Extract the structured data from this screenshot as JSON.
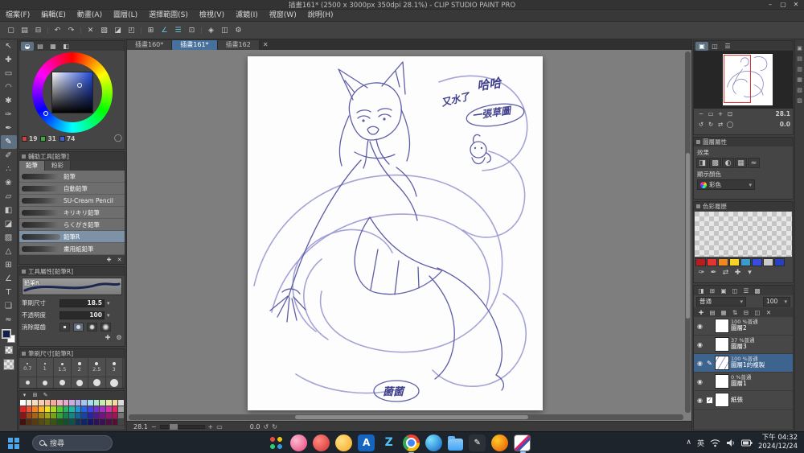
{
  "colors": {
    "accent": "#46719c",
    "selection": "#7d92a6",
    "layer_selection": "#3d648f",
    "foreground_color": "#131f4a",
    "sketch_line": "#9a9ad0",
    "taskbar": "#1d242c"
  },
  "glyphs": {
    "dropdown": "▾",
    "close": "✕",
    "eye": "◉",
    "edit": "✎",
    "check": "✓",
    "minus": "−",
    "plus": "+",
    "undo": "↺",
    "redo": "↻",
    "chevron_up": "∧",
    "fit": "▭",
    "app_a": "A",
    "app_z": "Z",
    "mix": "◯"
  },
  "window": {
    "title": "插畫161* (2500 x 3000px 350dpi 28.1%) - CLIP STUDIO PAINT PRO",
    "minimize": "–",
    "maximize": "▢",
    "close": "✕"
  },
  "menu": {
    "items": [
      "檔案(F)",
      "編輯(E)",
      "動畫(A)",
      "圖層(L)",
      "選擇範圍(S)",
      "檢視(V)",
      "濾鏡(I)",
      "視窗(W)",
      "說明(H)"
    ]
  },
  "toolbar": {
    "icons": [
      {
        "name": "new-file-icon",
        "glyph": "▢"
      },
      {
        "name": "open-file-icon",
        "glyph": "▤"
      },
      {
        "name": "save-file-icon",
        "glyph": "⊟"
      },
      {
        "name": "separator",
        "glyph": "|",
        "sep": true
      },
      {
        "name": "undo-icon",
        "glyph": "↶"
      },
      {
        "name": "redo-icon",
        "glyph": "↷"
      },
      {
        "name": "separator",
        "glyph": "|",
        "sep": true
      },
      {
        "name": "deselect-icon",
        "glyph": "✕"
      },
      {
        "name": "invert-selection-icon",
        "glyph": "▧"
      },
      {
        "name": "fill-icon",
        "glyph": "◪"
      },
      {
        "name": "transform-icon",
        "glyph": "◰"
      },
      {
        "name": "separator",
        "glyph": "|",
        "sep": true
      },
      {
        "name": "grid-icon",
        "glyph": "⊞"
      },
      {
        "name": "snap-ruler-icon",
        "glyph": "∠",
        "color": "#66c8e8"
      },
      {
        "name": "snap-special-ruler-icon",
        "glyph": "☰",
        "color": "#66c8e8"
      },
      {
        "name": "snap-grid-icon",
        "glyph": "⊡"
      },
      {
        "name": "separator",
        "glyph": "|",
        "sep": true
      },
      {
        "name": "symmetry-icon",
        "glyph": "◈"
      },
      {
        "name": "onion-skin-icon",
        "glyph": "◫"
      },
      {
        "name": "settings-gear-icon",
        "glyph": "⚙"
      }
    ]
  },
  "doc_tabs": {
    "tabs": [
      {
        "label": "插畫160*"
      },
      {
        "label": "插畫161*",
        "active": true
      },
      {
        "label": "插畫162"
      }
    ]
  },
  "tool_strip": {
    "icons": [
      {
        "name": "operate-tool-icon",
        "glyph": "↖"
      },
      {
        "name": "move-layer-tool-icon",
        "glyph": "✚"
      },
      {
        "name": "marquee-tool-icon",
        "glyph": "▭"
      },
      {
        "name": "lasso-tool-icon",
        "glyph": "◠"
      },
      {
        "name": "auto-select-tool-icon",
        "glyph": "✱"
      },
      {
        "name": "eyedropper-tool-icon",
        "glyph": "✑"
      },
      {
        "name": "pen-tool-icon",
        "glyph": "✒"
      },
      {
        "name": "pencil-tool-icon",
        "glyph": "✎",
        "active": true
      },
      {
        "name": "brush-tool-icon",
        "glyph": "✐"
      },
      {
        "name": "airbrush-tool-icon",
        "glyph": "∴"
      },
      {
        "name": "decoration-tool-icon",
        "glyph": "❀"
      },
      {
        "name": "eraser-tool-icon",
        "glyph": "▱"
      },
      {
        "name": "blend-tool-icon",
        "glyph": "◧"
      },
      {
        "name": "fill-tool-icon",
        "glyph": "◪"
      },
      {
        "name": "gradient-tool-icon",
        "glyph": "▨"
      },
      {
        "name": "figure-tool-icon",
        "glyph": "△"
      },
      {
        "name": "frame-border-tool-icon",
        "glyph": "⊞"
      },
      {
        "name": "ruler-tool-icon",
        "glyph": "∠"
      },
      {
        "name": "text-tool-icon",
        "glyph": "T"
      },
      {
        "name": "balloon-tool-icon",
        "glyph": "❏"
      },
      {
        "name": "line-correction-tool-icon",
        "glyph": "≈"
      }
    ]
  },
  "color_wheel": {
    "tabs": [
      {
        "name": "color-wheel-tab-icon",
        "glyph": "◒",
        "active": true
      },
      {
        "name": "color-slider-tab-icon",
        "glyph": "▤"
      },
      {
        "name": "color-set-tab-icon",
        "glyph": "▦"
      },
      {
        "name": "intermediate-color-tab-icon",
        "glyph": "◧"
      }
    ],
    "r": "19",
    "g": "31",
    "b": "74"
  },
  "sub_tool": {
    "title": "輔助工具[鉛筆]",
    "tabs": [
      "鉛筆",
      "粉彩"
    ],
    "items": [
      {
        "label": "鉛筆"
      },
      {
        "label": "自動鉛筆"
      },
      {
        "label": "SU-Cream Pencil"
      },
      {
        "label": "キリキリ鉛筆"
      },
      {
        "label": "らくがき鉛筆"
      },
      {
        "label": "鉛筆R",
        "selected": true
      },
      {
        "label": "畫用紙鉛筆"
      }
    ],
    "footer_icons": [
      {
        "name": "add-subtool-icon",
        "glyph": "✚"
      },
      {
        "name": "delete-subtool-icon",
        "glyph": "✕"
      }
    ]
  },
  "tool_property": {
    "title": "工具屬性[鉛筆R]",
    "brush_label": "鉛筆R",
    "size_label": "筆刷尺寸",
    "size_value": "18.5",
    "opacity_label": "不透明度",
    "opacity_value": "100",
    "aa_label": "消除鋸齒",
    "footer_icons": [
      {
        "name": "add-setting-icon",
        "glyph": "✚"
      },
      {
        "name": "wrench-icon",
        "glyph": "⚙"
      }
    ]
  },
  "brush_size": {
    "title": "筆刷尺寸[鉛筆R]",
    "presets": [
      "0.7",
      "1",
      "1.5",
      "2",
      "2.5",
      "3"
    ]
  },
  "color_set": {
    "header_icons": [
      {
        "name": "colorset-menu-icon",
        "glyph": "▾"
      },
      {
        "name": "colorset-grid-icon",
        "glyph": "⊞"
      },
      {
        "name": "colorset-edit-icon",
        "glyph": "✎"
      }
    ],
    "palette": [
      "#ffffff",
      "#f5ead8",
      "#f7ddc0",
      "#f8cfae",
      "#f6c0a0",
      "#f2aa9a",
      "#eeb4c0",
      "#e4a9cf",
      "#cfa8e0",
      "#b4ace8",
      "#a9c4f0",
      "#a8dcec",
      "#aee8cc",
      "#c6ecae",
      "#e6eca6",
      "#f2d9a2",
      "#dcdcdc",
      "#e02424",
      "#ee5430",
      "#f48222",
      "#f6b322",
      "#f4e022",
      "#abd622",
      "#54c434",
      "#22b464",
      "#22b4a4",
      "#2292d4",
      "#2464e4",
      "#4242e2",
      "#7232d2",
      "#a232c4",
      "#d232a4",
      "#e22462",
      "#a4a4a4",
      "#8c1414",
      "#a44414",
      "#a46414",
      "#a48414",
      "#a4a414",
      "#74a414",
      "#34a434",
      "#148454",
      "#148484",
      "#146494",
      "#1444a4",
      "#2424a4",
      "#541494",
      "#741484",
      "#941474",
      "#a41454",
      "#747474",
      "#461010",
      "#542c10",
      "#543c10",
      "#544c10",
      "#545c10",
      "#3c5410",
      "#1c541c",
      "#10502c",
      "#10504c",
      "#103458",
      "#102468",
      "#161664",
      "#2c105c",
      "#3c1054",
      "#4c1044",
      "#541034",
      "#444444"
    ]
  },
  "canvas": {
    "zoom": "28.1",
    "rotation": "0.0",
    "note1": "哈哈",
    "note2": "又水了",
    "note3": "一張草圖",
    "signature": "菌菌"
  },
  "navigator": {
    "tabs": [
      {
        "name": "navigator-tab-icon",
        "glyph": "▣",
        "active": true
      },
      {
        "name": "subview-tab-icon",
        "glyph": "◫"
      },
      {
        "name": "information-tab-icon",
        "glyph": "☰"
      }
    ],
    "zoom_icons": [
      {
        "name": "zoom-out-icon",
        "glyph": "−"
      },
      {
        "name": "zoom-slider-icon",
        "glyph": "▭"
      },
      {
        "name": "zoom-in-icon",
        "glyph": "+"
      },
      {
        "name": "fit-window-icon",
        "glyph": "⊡"
      }
    ],
    "rotate_icons": [
      {
        "name": "rotate-left-icon",
        "glyph": "↺"
      },
      {
        "name": "rotate-right-icon",
        "glyph": "↻"
      },
      {
        "name": "flip-horizontal-icon",
        "glyph": "⇄"
      },
      {
        "name": "reset-rotation-icon",
        "glyph": "◯"
      }
    ],
    "zoom": "28.1",
    "rotation": "0.0"
  },
  "layer_property": {
    "title": "圖層屬性",
    "effect_label": "效果",
    "effect_icons": [
      {
        "name": "border-effect-icon",
        "glyph": "◨"
      },
      {
        "name": "tone-effect-icon",
        "glyph": "▩"
      },
      {
        "name": "layer-color-effect-icon",
        "glyph": "◐"
      },
      {
        "name": "extract-line-effect-icon",
        "glyph": "▦"
      },
      {
        "name": "effect-more-icon",
        "glyph": "≈"
      }
    ],
    "color_mode_label": "顯示顏色",
    "color_mode_value": "彩色"
  },
  "color_history": {
    "title": "色彩履歷",
    "quick": [
      "#b81c1c",
      "#e63232",
      "#f08822",
      "#f8d422",
      "#3a9ccc",
      "#3a4ce0",
      "#cccccc",
      "#2840c0"
    ],
    "tool_icons": [
      {
        "name": "eyedropper-small-icon",
        "glyph": "✑"
      },
      {
        "name": "pen-small-icon",
        "glyph": "✒"
      },
      {
        "name": "swap-color-icon",
        "glyph": "⇄"
      },
      {
        "name": "add-color-icon",
        "glyph": "✚"
      },
      {
        "name": "history-menu-icon",
        "glyph": "▾"
      }
    ]
  },
  "layer_panel": {
    "header_icons": [
      {
        "name": "layer-mask-icon",
        "glyph": "◨"
      },
      {
        "name": "clip-to-layer-icon",
        "glyph": "⊞"
      },
      {
        "name": "reference-layer-icon",
        "glyph": "▣"
      },
      {
        "name": "draft-layer-icon",
        "glyph": "◫"
      },
      {
        "name": "lock-layer-icon",
        "glyph": "☰"
      },
      {
        "name": "lock-transparent-icon",
        "glyph": "▩"
      }
    ],
    "blend_mode": "普通",
    "opacity": "100",
    "cmd_icons": [
      {
        "name": "new-layer-icon",
        "glyph": "✚"
      },
      {
        "name": "new-vector-layer-icon",
        "glyph": "▤"
      },
      {
        "name": "new-folder-icon",
        "glyph": "▦"
      },
      {
        "name": "change-order-icon",
        "glyph": "⇅"
      },
      {
        "name": "merge-down-icon",
        "glyph": "⊟"
      },
      {
        "name": "apply-mask-icon",
        "glyph": "◫"
      },
      {
        "name": "delete-layer-icon",
        "glyph": "✕"
      }
    ],
    "layers": [
      {
        "info": "100 %普通",
        "name": "圖層2"
      },
      {
        "info": "37 %普通",
        "name": "圖層3"
      },
      {
        "info": "100 %普通",
        "name": "圖層1的複製",
        "selected": true
      },
      {
        "info": "0 %普通",
        "name": "圖層1"
      },
      {
        "info": "",
        "name": "紙張",
        "is_paper": true
      }
    ]
  },
  "material_strip": {
    "icons": [
      {
        "name": "material-tab-1-icon",
        "glyph": "▣"
      },
      {
        "name": "material-tab-2-icon",
        "glyph": "▤"
      },
      {
        "name": "material-tab-3-icon",
        "glyph": "▥"
      },
      {
        "name": "material-tab-4-icon",
        "glyph": "▦"
      },
      {
        "name": "material-tab-5-icon",
        "glyph": "▧"
      },
      {
        "name": "material-tab-6-icon",
        "glyph": "▨"
      }
    ]
  },
  "taskbar": {
    "search": "搜尋",
    "ime": "英",
    "time": "下午 04:32",
    "date": "2024/12/24"
  }
}
